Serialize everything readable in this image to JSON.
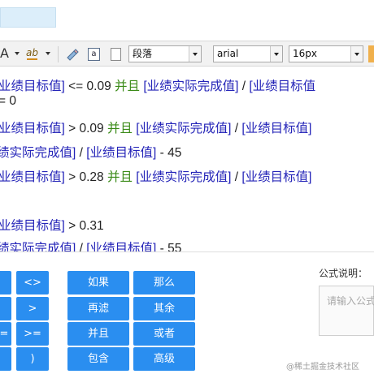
{
  "toolbar": {
    "font_color_label": "A",
    "highlight_label": "ab",
    "paragraph_format": "段落",
    "font_family": "arial",
    "font_size": "16px"
  },
  "editor": {
    "lines": [
      [
        {
          "t": "业绩目标值]",
          "c": "f"
        },
        {
          "t": " <= 0.09 ",
          "c": "n"
        },
        {
          "t": "并且",
          "c": "k"
        },
        {
          "t": " [业绩实际完成值]",
          "c": "f"
        },
        {
          "t": " / ",
          "c": "n"
        },
        {
          "t": "[业绩目标值",
          "c": "f"
        }
      ],
      [
        {
          "t": "= 0",
          "c": "n"
        }
      ],
      [
        {
          "t": "业绩目标值]",
          "c": "f"
        },
        {
          "t": " > 0.09 ",
          "c": "n"
        },
        {
          "t": "并且",
          "c": "k"
        },
        {
          "t": " [业绩实际完成值]",
          "c": "f"
        },
        {
          "t": " / ",
          "c": "n"
        },
        {
          "t": "[业绩目标值]",
          "c": "f"
        }
      ],
      [
        {
          "t": "绩实际完成值]",
          "c": "f"
        },
        {
          "t": " / ",
          "c": "n"
        },
        {
          "t": "[业绩目标值]",
          "c": "f"
        },
        {
          "t": " - 45",
          "c": "n"
        }
      ],
      [
        {
          "t": "业绩目标值]",
          "c": "f"
        },
        {
          "t": " > 0.28 ",
          "c": "n"
        },
        {
          "t": "并且",
          "c": "k"
        },
        {
          "t": " [业绩实际完成值]",
          "c": "f"
        },
        {
          "t": " / ",
          "c": "n"
        },
        {
          "t": "[业绩目标值]",
          "c": "f"
        }
      ],
      [],
      [
        {
          "t": "业绩目标值]",
          "c": "f"
        },
        {
          "t": " > 0.31",
          "c": "n"
        }
      ],
      [
        {
          "t": "绩实际完成值]",
          "c": "f"
        },
        {
          "t": " / ",
          "c": "n"
        },
        {
          "t": "[业绩目标值]",
          "c": "f"
        },
        {
          "t": " - 55",
          "c": "n"
        }
      ]
    ]
  },
  "buttons": {
    "operators": [
      "<>",
      ">",
      ">=",
      ")"
    ],
    "keywords": [
      "如果",
      "那么",
      "再滤",
      "其余",
      "并且",
      "或者",
      "包含",
      "高级"
    ]
  },
  "description": {
    "label": "公式说明：",
    "placeholder": "请输入公式说明…"
  },
  "watermark": "@稀土掘金技术社区",
  "colors": {
    "field": "#2424b8",
    "keyword": "#3a8a17",
    "button": "#2a8ef0"
  }
}
